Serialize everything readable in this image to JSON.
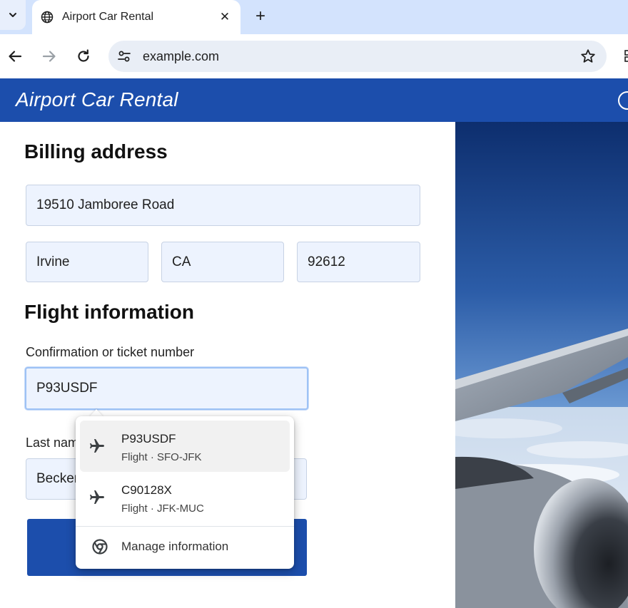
{
  "browser": {
    "tab_title": "Airport Car Rental",
    "url": "example.com",
    "new_tab_glyph": "+",
    "close_glyph": "✕",
    "icons": [
      "tab-list-chevron-icon",
      "globe-icon",
      "back-arrow-icon",
      "forward-arrow-icon",
      "reload-icon",
      "site-info-icon",
      "bookmark-star-icon"
    ]
  },
  "site": {
    "title": "Airport Car Rental"
  },
  "billing": {
    "heading": "Billing address",
    "street": "19510 Jamboree Road",
    "city": "Irvine",
    "state": "CA",
    "zip": "92612"
  },
  "flight": {
    "heading": "Flight information",
    "confirmation_label": "Confirmation or ticket number",
    "confirmation_value": "P93USDF",
    "last_name_label": "Last name",
    "last_name_value": "Becker"
  },
  "autofill": {
    "suggestions": [
      {
        "value": "P93USDF",
        "detail": "Flight · SFO-JFK",
        "icon": "airplane-icon"
      },
      {
        "value": "C90128X",
        "detail": "Flight · JFK-MUC",
        "icon": "airplane-icon"
      }
    ],
    "manage_label": "Manage information"
  },
  "colors": {
    "brand_blue": "#1c4eac",
    "tab_strip": "#d3e3fd",
    "field_bg": "#edf3fe"
  }
}
